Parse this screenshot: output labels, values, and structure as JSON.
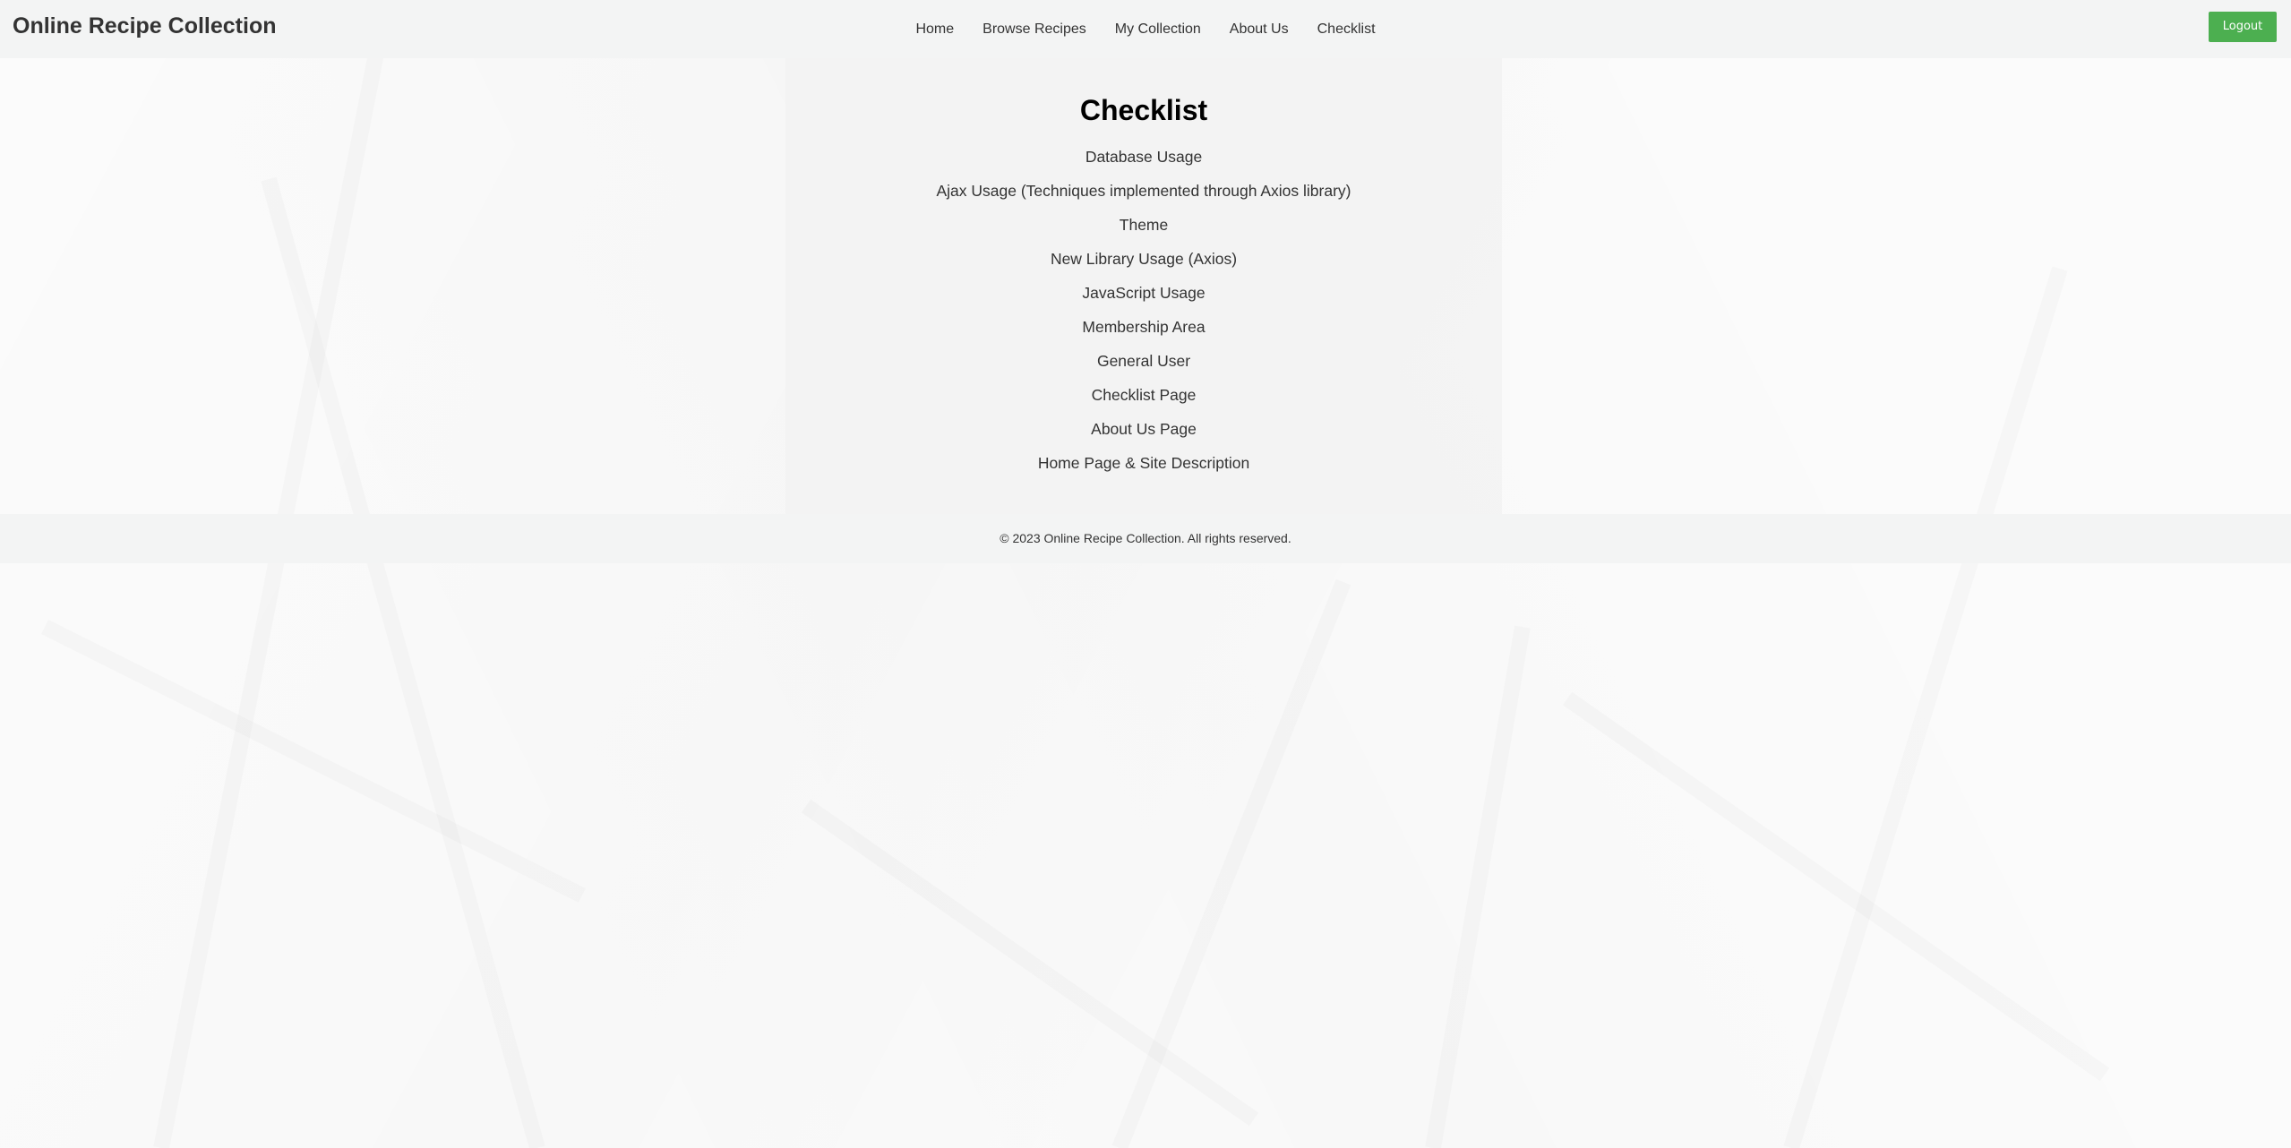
{
  "header": {
    "brand": "Online Recipe Collection",
    "nav": [
      {
        "label": "Home"
      },
      {
        "label": "Browse Recipes"
      },
      {
        "label": "My Collection"
      },
      {
        "label": "About Us"
      },
      {
        "label": "Checklist"
      }
    ],
    "logout_label": "Logout"
  },
  "main": {
    "title": "Checklist",
    "items": [
      "Database Usage",
      "Ajax Usage (Techniques implemented through Axios library)",
      "Theme",
      "New Library Usage (Axios)",
      "JavaScript Usage",
      "Membership Area",
      "General User",
      "Checklist Page",
      "About Us Page",
      "Home Page & Site Description"
    ]
  },
  "footer": {
    "copyright": "© 2023 Online Recipe Collection. All rights reserved."
  },
  "colors": {
    "accent": "#4caf50",
    "header_bg": "#f2f3f3",
    "text": "#333333"
  }
}
